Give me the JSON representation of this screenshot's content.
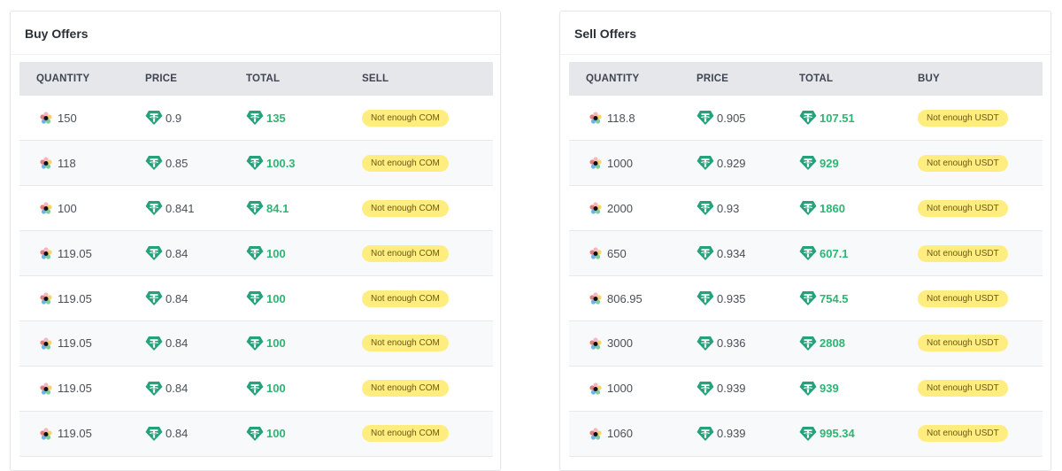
{
  "buy": {
    "title": "Buy Offers",
    "headers": [
      "QUANTITY",
      "PRICE",
      "TOTAL",
      "SELL"
    ],
    "action_label": "Not enough COM",
    "rows": [
      {
        "quantity": "150",
        "price": "0.9",
        "total": "135"
      },
      {
        "quantity": "118",
        "price": "0.85",
        "total": "100.3"
      },
      {
        "quantity": "100",
        "price": "0.841",
        "total": "84.1"
      },
      {
        "quantity": "119.05",
        "price": "0.84",
        "total": "100"
      },
      {
        "quantity": "119.05",
        "price": "0.84",
        "total": "100"
      },
      {
        "quantity": "119.05",
        "price": "0.84",
        "total": "100"
      },
      {
        "quantity": "119.05",
        "price": "0.84",
        "total": "100"
      },
      {
        "quantity": "119.05",
        "price": "0.84",
        "total": "100"
      }
    ]
  },
  "sell": {
    "title": "Sell Offers",
    "headers": [
      "QUANTITY",
      "PRICE",
      "TOTAL",
      "BUY"
    ],
    "action_label": "Not enough USDT",
    "rows": [
      {
        "quantity": "118.8",
        "price": "0.905",
        "total": "107.51"
      },
      {
        "quantity": "1000",
        "price": "0.929",
        "total": "929"
      },
      {
        "quantity": "2000",
        "price": "0.93",
        "total": "1860"
      },
      {
        "quantity": "650",
        "price": "0.934",
        "total": "607.1"
      },
      {
        "quantity": "806.95",
        "price": "0.935",
        "total": "754.5"
      },
      {
        "quantity": "3000",
        "price": "0.936",
        "total": "2808"
      },
      {
        "quantity": "1000",
        "price": "0.939",
        "total": "939"
      },
      {
        "quantity": "1060",
        "price": "0.939",
        "total": "995.34"
      }
    ]
  },
  "icons": {
    "quantity": "commercium-coin-icon",
    "price": "tether-usdt-icon",
    "total": "tether-usdt-icon"
  },
  "colors": {
    "tether": "#26a17b",
    "total_text": "#2bb673",
    "badge_bg": "#ffed7f",
    "header_bg": "#e6e7eb"
  }
}
